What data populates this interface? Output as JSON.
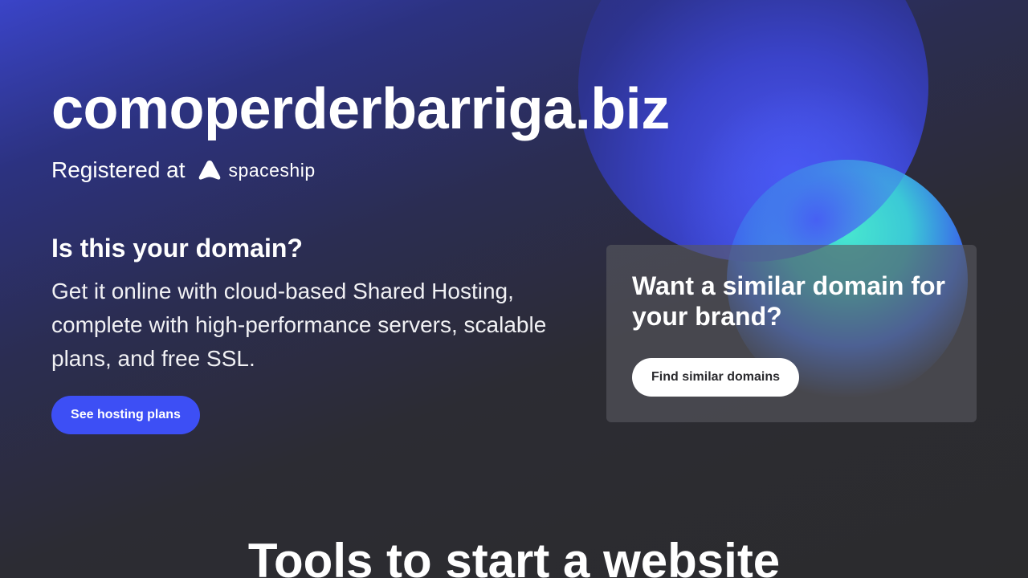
{
  "hero": {
    "domain": "comoperderbarriga.biz",
    "registered_prefix": "Registered at",
    "registrar": {
      "name": "spaceship",
      "icon": "spaceship-logo-icon"
    }
  },
  "ownership": {
    "heading": "Is this your domain?",
    "description": "Get it online with cloud-based Shared Hosting, complete with high-performance servers, scalable plans, and free SSL.",
    "cta_label": "See hosting plans"
  },
  "similar_card": {
    "title": "Want a similar domain for your brand?",
    "cta_label": "Find similar domains"
  },
  "tools": {
    "heading": "Tools to start a website"
  },
  "colors": {
    "primary_button": "#3d4ff5",
    "teal_accent": "#47e6cf",
    "background_dark": "#2b2b2d"
  }
}
